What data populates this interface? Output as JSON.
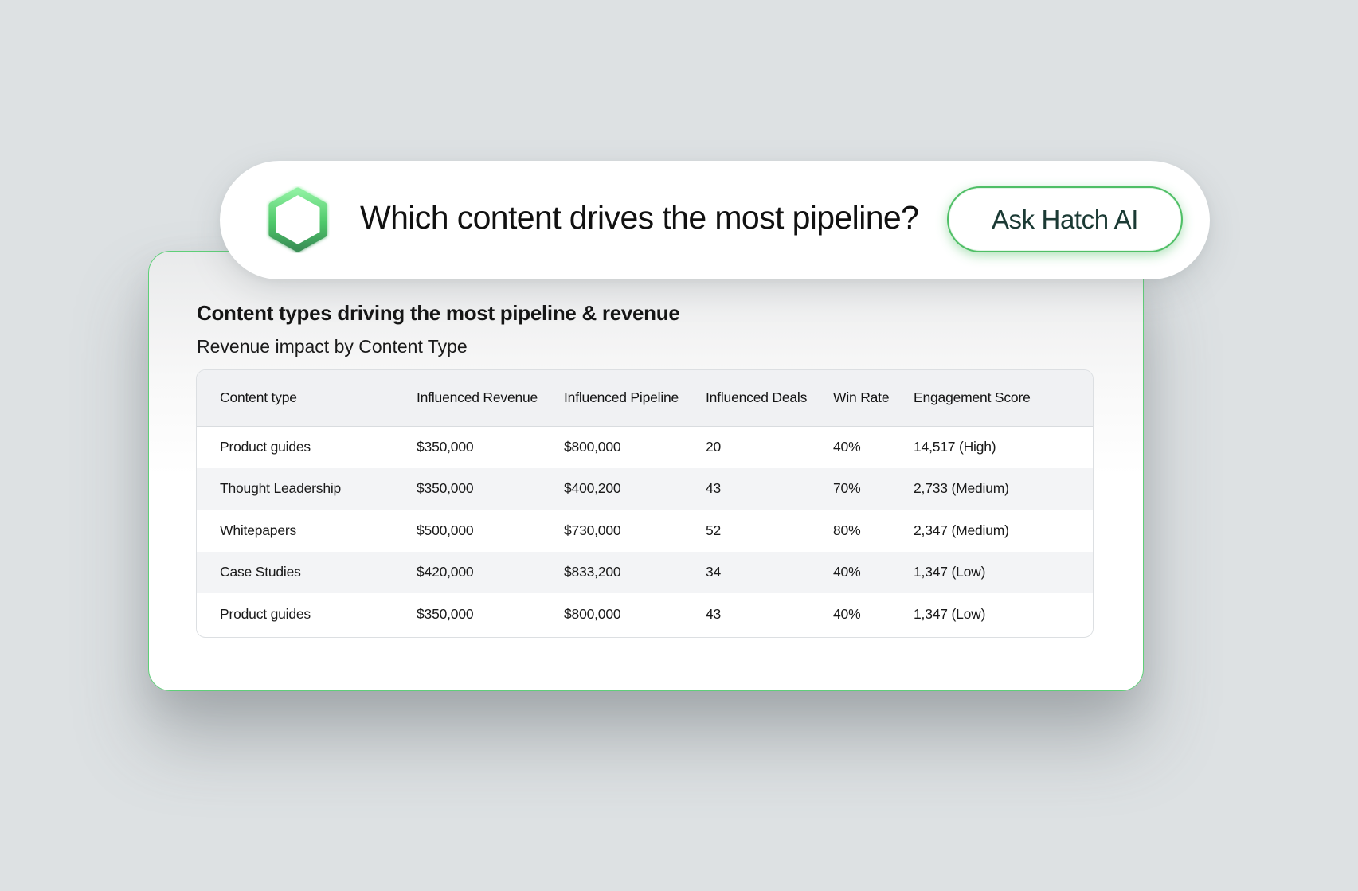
{
  "prompt": {
    "question": "Which content drives the most pipeline?",
    "button_label": "Ask Hatch AI",
    "logo_icon": "hexagon-logo-icon",
    "accent": "#4fbf66"
  },
  "card": {
    "title": "Content types driving the most pipeline & revenue",
    "subtitle": "Revenue impact by Content Type"
  },
  "table": {
    "headers": [
      "Content type",
      "Influenced Revenue",
      "Influenced Pipeline",
      "Influenced Deals",
      "Win Rate",
      "Engagement Score"
    ],
    "rows": [
      [
        "Product guides",
        "$350,000",
        "$800,000",
        "20",
        "40%",
        "14,517 (High)"
      ],
      [
        "Thought Leadership",
        "$350,000",
        "$400,200",
        "43",
        "70%",
        "2,733 (Medium)"
      ],
      [
        "Whitepapers",
        "$500,000",
        "$730,000",
        "52",
        "80%",
        "2,347 (Medium)"
      ],
      [
        "Case Studies",
        "$420,000",
        "$833,200",
        "34",
        "40%",
        "1,347 (Low)"
      ],
      [
        "Product guides",
        "$350,000",
        "$800,000",
        "43",
        "40%",
        "1,347 (Low)"
      ]
    ]
  }
}
